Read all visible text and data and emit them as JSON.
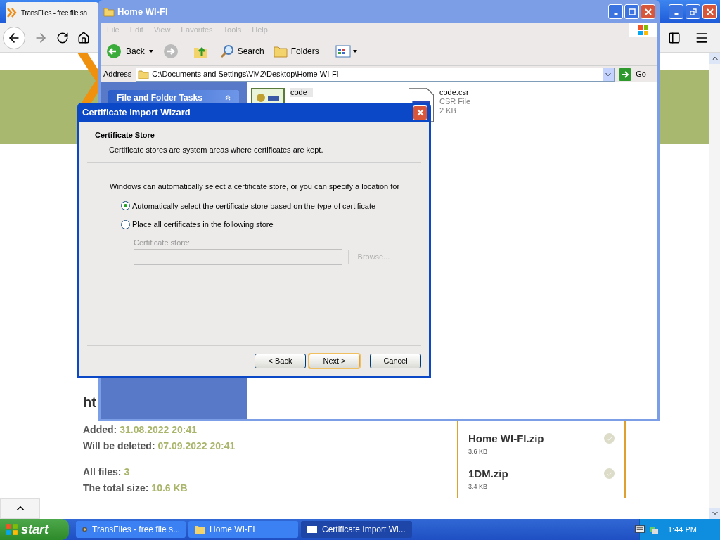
{
  "browser": {
    "tab_title": "TransFiles - free file sh",
    "page": {
      "heading": "ht",
      "info": [
        {
          "label": "Added:",
          "value": "31.08.2022 20:41"
        },
        {
          "label": "Will be deleted:",
          "value": "07.09.2022 20:41"
        },
        {
          "label": "All files:",
          "value": "3"
        },
        {
          "label": "The total size:",
          "value": "10.6 KB"
        }
      ],
      "files": [
        {
          "name": "Home WI-FI.zip",
          "size": "3.6 KB"
        },
        {
          "name": "1DM.zip",
          "size": "3.4 KB"
        }
      ]
    }
  },
  "explorer": {
    "title": "Home WI-FI",
    "menu": [
      {
        "label": "File",
        "disabled": true
      },
      {
        "label": "Edit",
        "disabled": true
      },
      {
        "label": "View",
        "disabled": true
      },
      {
        "label": "Favorites",
        "disabled": true
      },
      {
        "label": "Tools",
        "disabled": true
      },
      {
        "label": "Help",
        "disabled": true
      }
    ],
    "back": "Back",
    "search": "Search",
    "folders": "Folders",
    "address_label": "Address",
    "address": "C:\\Documents and Settings\\VM2\\Desktop\\Home WI-FI",
    "go": "Go",
    "task_panel": "File and Folder Tasks",
    "files": [
      {
        "name": "code",
        "kind": "certificate",
        "selected": true
      },
      {
        "name": "code.csr",
        "type": "CSR File",
        "size": "2 KB",
        "kind": "document",
        "selected": false
      }
    ]
  },
  "dialog": {
    "title": "Certificate Import Wizard",
    "heading": "Certificate Store",
    "subheading": "Certificate stores are system areas where certificates are kept.",
    "intro": "Windows can automatically select a certificate store, or you can specify a location for",
    "options": [
      {
        "label": "Automatically select the certificate store based on the type of certificate",
        "selected": true
      },
      {
        "label": "Place all certificates in the following store",
        "selected": false
      }
    ],
    "store_label": "Certificate store:",
    "store_disabled": true,
    "browse": "Browse...",
    "buttons": [
      {
        "label": "< Back",
        "kind": "normal"
      },
      {
        "label": "Next >",
        "kind": "default"
      },
      {
        "label": "Cancel",
        "kind": "normal"
      }
    ]
  },
  "taskbar": {
    "start": "start",
    "tasks": [
      {
        "label": "TransFiles - free file s...",
        "kind": "browser",
        "selected": false
      },
      {
        "label": "Home WI-FI",
        "kind": "folder",
        "selected": false
      },
      {
        "label": "Certificate Import Wi...",
        "kind": "window",
        "selected": true
      }
    ],
    "clock": "1:44 PM"
  }
}
